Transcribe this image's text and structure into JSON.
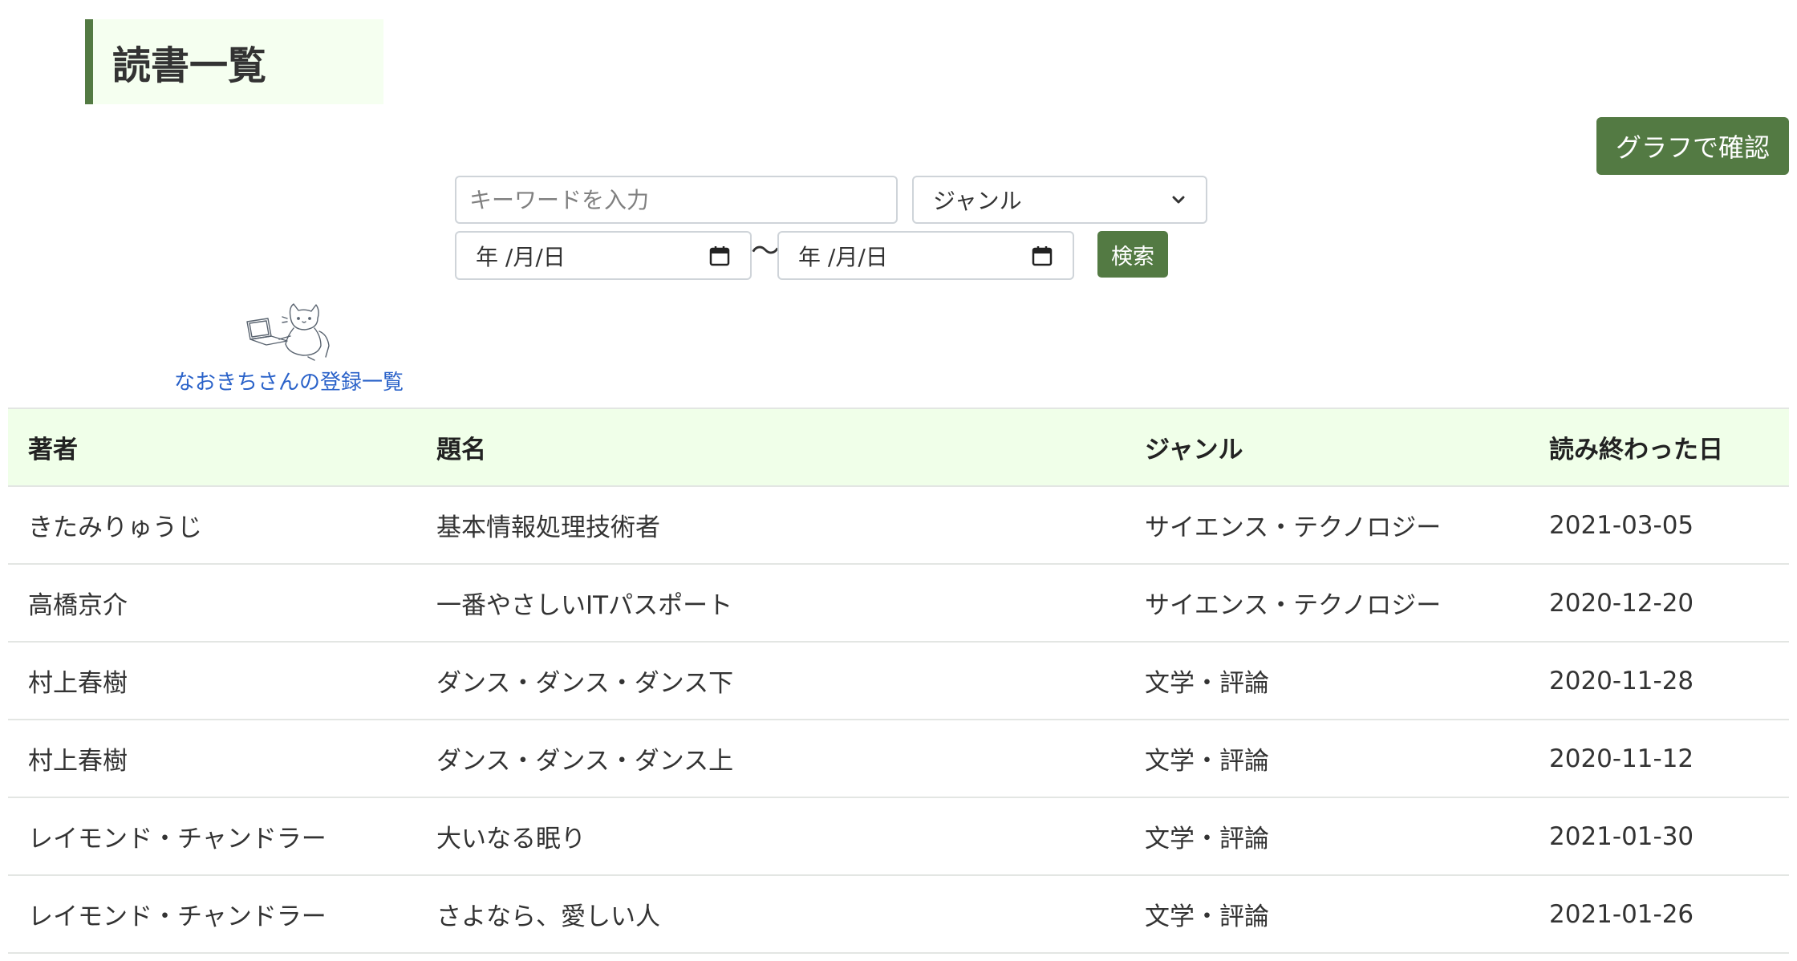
{
  "page": {
    "title": "読書一覧"
  },
  "actions": {
    "graph_button_label": "グラフで確認",
    "search_button_label": "検索"
  },
  "search": {
    "keyword_placeholder": "キーワードを入力",
    "genre_selected": "ジャンル",
    "date_from_placeholder": "年 /月/日",
    "date_to_placeholder": "年 /月/日",
    "range_separator": "〜"
  },
  "user": {
    "link_text": "なおきちさんの登録一覧"
  },
  "table": {
    "headers": {
      "author": "著者",
      "title": "題名",
      "genre": "ジャンル",
      "finished_date": "読み終わった日"
    },
    "rows": [
      {
        "author": "きたみりゅうじ",
        "title": "基本情報処理技術者",
        "genre": "サイエンス・テクノロジー",
        "finished_date": "2021-03-05"
      },
      {
        "author": "高橋京介",
        "title": "一番やさしいITパスポート",
        "genre": "サイエンス・テクノロジー",
        "finished_date": "2020-12-20"
      },
      {
        "author": "村上春樹",
        "title": "ダンス・ダンス・ダンス下",
        "genre": "文学・評論",
        "finished_date": "2020-11-28"
      },
      {
        "author": "村上春樹",
        "title": "ダンス・ダンス・ダンス上",
        "genre": "文学・評論",
        "finished_date": "2020-11-12"
      },
      {
        "author": "レイモンド・チャンドラー",
        "title": "大いなる眠り",
        "genre": "文学・評論",
        "finished_date": "2021-01-30"
      },
      {
        "author": "レイモンド・チャンドラー",
        "title": "さよなら、愛しい人",
        "genre": "文学・評論",
        "finished_date": "2021-01-26"
      }
    ]
  },
  "colors": {
    "accent": "#537a43",
    "header_bg": "#f0ffe9",
    "title_bg": "#f5fff0",
    "link": "#2a62c9"
  },
  "icons": {
    "calendar": "calendar-icon",
    "chevron": "chevron-down-icon",
    "illustration": "cat-with-laptop-illustration"
  }
}
